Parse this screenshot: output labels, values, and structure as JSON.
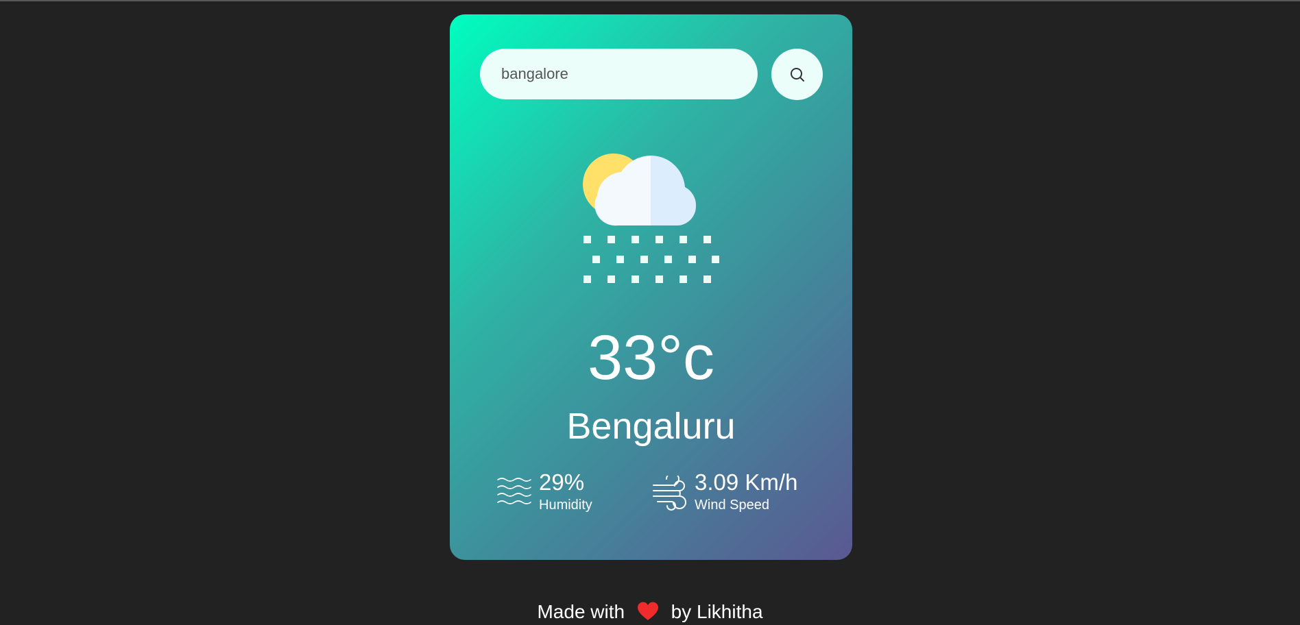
{
  "search": {
    "value": "bangalore",
    "icon": "search-icon"
  },
  "weather": {
    "icon": "snow-cloud-sun-icon",
    "temperature": "33°c",
    "city": "Bengaluru"
  },
  "details": {
    "humidity": {
      "icon": "humidity-waves-icon",
      "value": "29%",
      "label": "Humidity"
    },
    "wind": {
      "icon": "wind-icon",
      "value": "3.09 Km/h",
      "label": "Wind Speed"
    }
  },
  "footer": {
    "prefix": "Made with",
    "suffix": "by Likhitha",
    "icon": "heart-icon"
  },
  "colors": {
    "background": "#222222",
    "card_gradient_start": "#00fec0",
    "card_gradient_end": "#5a5891",
    "input_background": "#ebfef9",
    "heart": "#ef2b2b",
    "sun": "#ffe069"
  }
}
